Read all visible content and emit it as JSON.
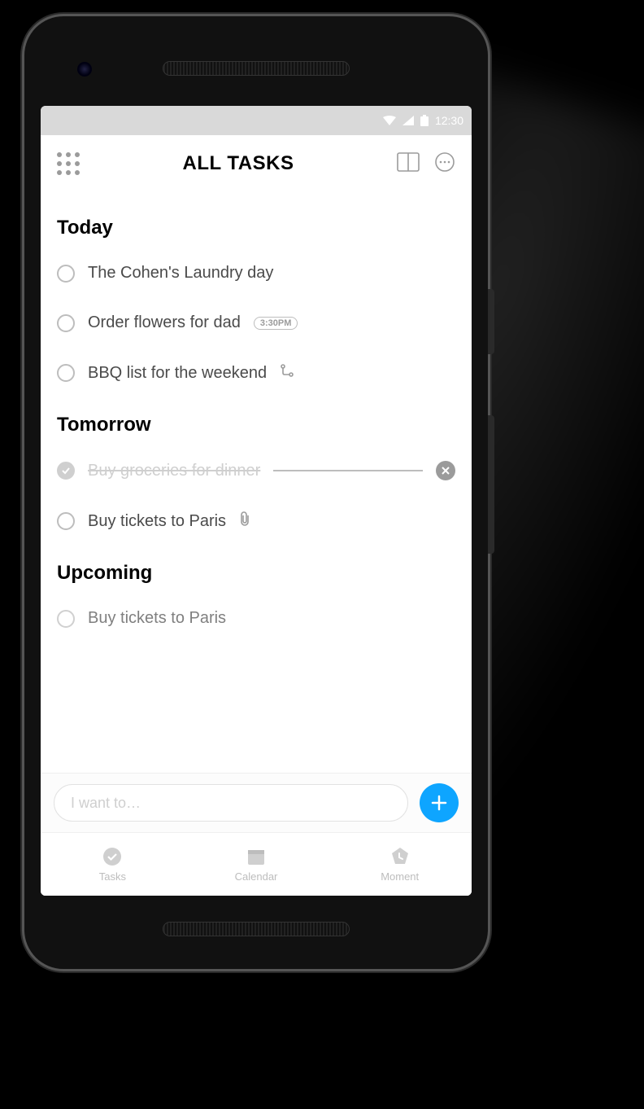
{
  "status_bar": {
    "time": "12:30"
  },
  "header": {
    "title": "ALL TASKS"
  },
  "sections": {
    "today": {
      "title": "Today",
      "tasks": [
        {
          "title": "The Cohen's Laundry day"
        },
        {
          "title": "Order flowers for dad",
          "time": "3:30PM"
        },
        {
          "title": "BBQ list for the weekend",
          "has_subtasks": true
        }
      ]
    },
    "tomorrow": {
      "title": "Tomorrow",
      "tasks": [
        {
          "title": "Buy groceries for dinner",
          "completed": true
        },
        {
          "title": "Buy tickets to Paris",
          "has_attachment": true
        }
      ]
    },
    "upcoming": {
      "title": "Upcoming",
      "tasks": [
        {
          "title": "Buy tickets to Paris"
        }
      ]
    }
  },
  "input": {
    "placeholder": "I want to…"
  },
  "nav": {
    "tasks": "Tasks",
    "calendar": "Calendar",
    "moment": "Moment"
  },
  "colors": {
    "accent": "#0ea5ff"
  }
}
